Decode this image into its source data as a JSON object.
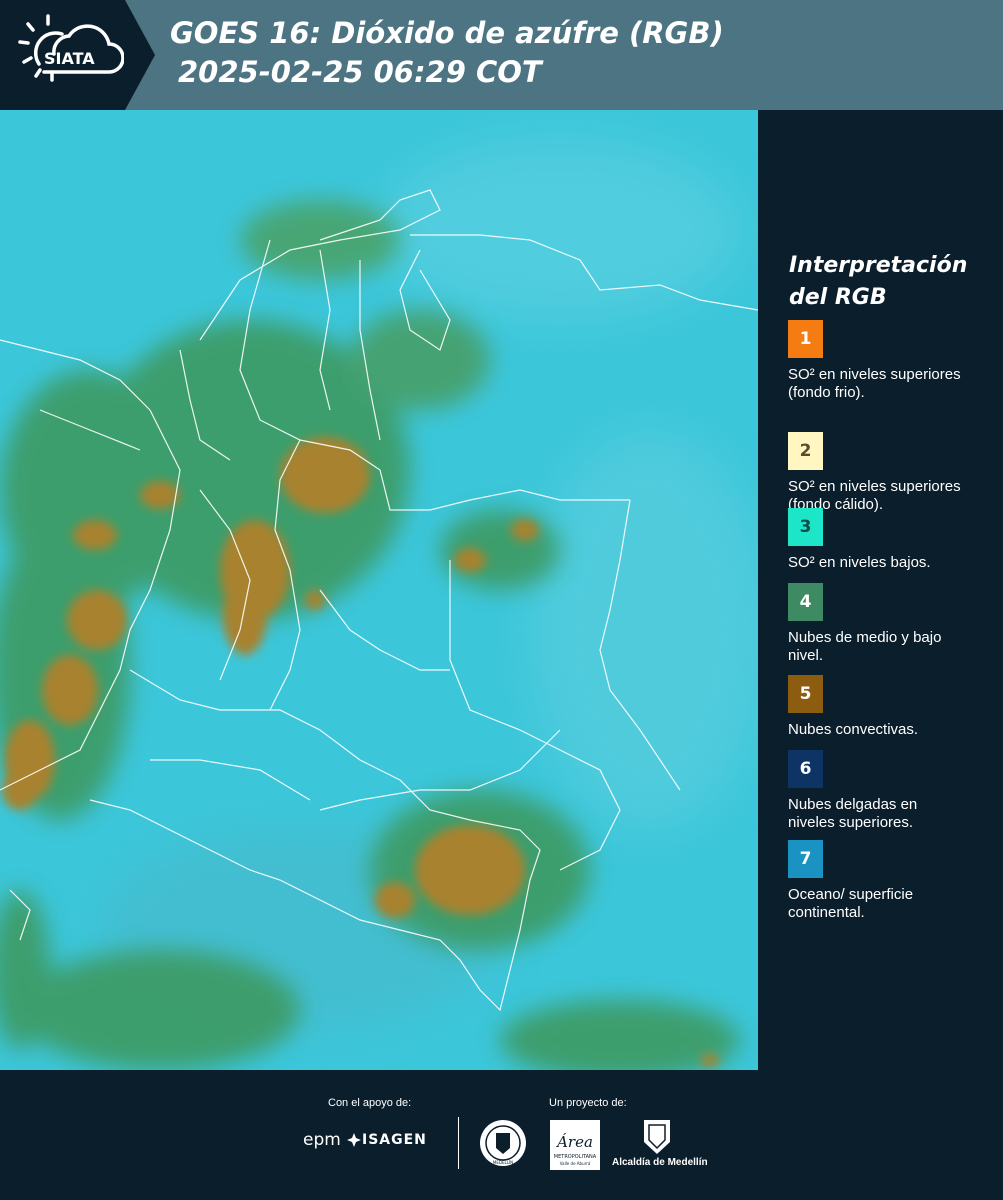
{
  "header": {
    "logo_text": "SIATA",
    "title_line1": "GOES 16: Dióxido de azúfre (RGB)",
    "title_line2": "2025-02-25 06:29 COT"
  },
  "legend": {
    "title_line1": "Interpretación",
    "title_line2": "del RGB",
    "items": [
      {
        "number": "1",
        "color": "#f47c12",
        "text_color": "#ffffff",
        "text": "SO² en niveles superiores (fondo frio)."
      },
      {
        "number": "2",
        "color": "#fff6c2",
        "text_color": "#5a4b2a",
        "text": "SO² en niveles superiores (fondo cálido)."
      },
      {
        "number": "3",
        "color": "#1de6c8",
        "text_color": "#0b4f48",
        "text": "SO² en niveles bajos."
      },
      {
        "number": "4",
        "color": "#3e8a62",
        "text_color": "#ffffff",
        "text": "Nubes de medio y bajo nivel."
      },
      {
        "number": "5",
        "color": "#8c5d10",
        "text_color": "#ffffff",
        "text": "Nubes convectivas."
      },
      {
        "number": "6",
        "color": "#0e3466",
        "text_color": "#ffffff",
        "text": "Nubes delgadas en niveles superiores."
      },
      {
        "number": "7",
        "color": "#1a93c2",
        "text_color": "#ffffff",
        "text": "Oceano/ superficie continental."
      }
    ]
  },
  "footer": {
    "support_label": "Con el apoyo de:",
    "project_label": "Un proyecto de:",
    "sponsor_epm": "epm",
    "sponsor_isagen": "ISAGEN",
    "seal_text": "MEDELLÍN",
    "area_logo_text": "Área",
    "area_logo_subtext": "METROPOLITANA",
    "area_logo_subtext2": "Valle de Aburrá",
    "alcaldia": "Alcaldía de Medellín"
  },
  "colors": {
    "background": "#0b1e2b",
    "header": "#4d7482",
    "ocean": "#3cc6da",
    "convective_cloud": "#a8822e",
    "mid_low_cloud": "#3e9a62",
    "border_lines": "#ffffff"
  }
}
